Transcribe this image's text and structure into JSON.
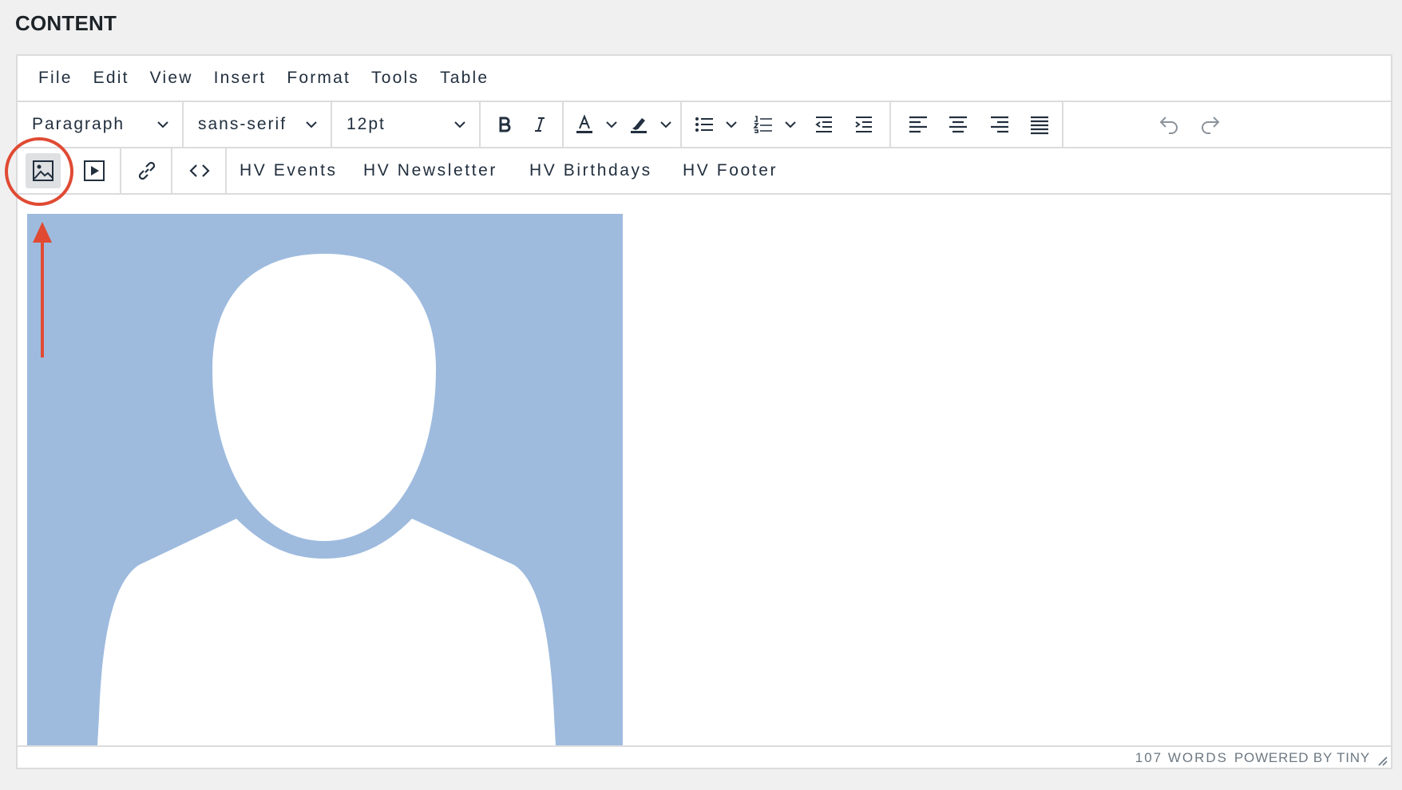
{
  "page": {
    "section_title": "CONTENT"
  },
  "menubar": {
    "items": [
      "File",
      "Edit",
      "View",
      "Insert",
      "Format",
      "Tools",
      "Table"
    ]
  },
  "toolbar": {
    "block_format": "Paragraph",
    "font_family": "sans-serif",
    "font_size": "12pt",
    "templates": [
      "HV Events",
      "HV Newsletter",
      "HV Birthdays",
      "HV Footer"
    ]
  },
  "statusbar": {
    "word_count": "107 WORDS",
    "powered_by": "POWERED BY TINY"
  },
  "colors": {
    "background": "#f0f0f1",
    "editor_border": "#dcdcde",
    "icon": "#222f3e",
    "placeholder_bg": "#9ebbde",
    "annotation": "#e04a33",
    "active_button_bg": "#dee0e2"
  },
  "icons": {
    "toolbar": [
      "bold-icon",
      "italic-icon",
      "text-color-icon",
      "highlight-color-icon",
      "bullet-list-icon",
      "numbered-list-icon",
      "outdent-icon",
      "indent-icon",
      "align-left-icon",
      "align-center-icon",
      "align-right-icon",
      "align-justify-icon",
      "undo-icon",
      "redo-icon"
    ],
    "insert": [
      "image-icon",
      "media-icon",
      "link-icon",
      "code-icon"
    ]
  },
  "annotation": {
    "highlighted_button": "image-icon"
  }
}
